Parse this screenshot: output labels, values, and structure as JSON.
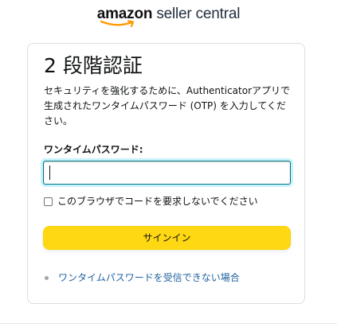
{
  "logo": {
    "amazon": "amazon",
    "seller_central": " seller central",
    "smile_color": "#ff9900"
  },
  "card": {
    "title": "2 段階認証",
    "description": "セキュリティを強化するために、Authenticatorアプリで生成されたワンタイムパスワード (OTP) を入力してください。",
    "otp_label": "ワンタイムパスワード:",
    "otp_value": "",
    "remember_checked": false,
    "remember_label": "このブラウザでコードを要求しないでください",
    "signin_button": "サインイン",
    "help_links": [
      "ワンタイムパスワードを受信できない場合"
    ]
  },
  "colors": {
    "button_bg": "#ffd814",
    "link": "#2162a1",
    "input_focus_border": "#007185",
    "input_focus_glow": "#c8f3fa"
  }
}
